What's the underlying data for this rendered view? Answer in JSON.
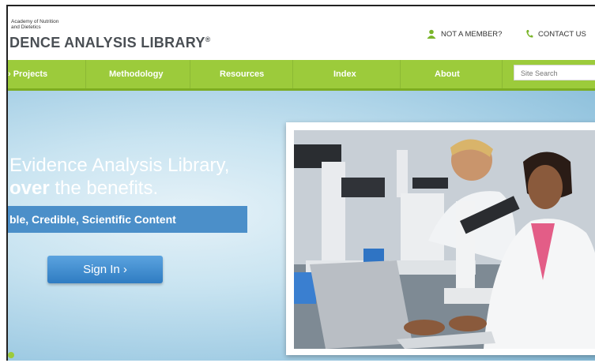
{
  "header": {
    "org_line1": "Academy of Nutrition",
    "org_line2": "and Dietetics",
    "title": "DENCE ANALYSIS LIBRARY",
    "title_mark": "®",
    "not_member": "NOT A MEMBER?",
    "contact_us": "CONTACT US"
  },
  "nav": {
    "items": [
      {
        "label": "› Projects"
      },
      {
        "label": "Methodology"
      },
      {
        "label": "Resources"
      },
      {
        "label": "Index"
      },
      {
        "label": "About"
      }
    ],
    "search_placeholder": "Site Search"
  },
  "hero": {
    "headline_line1": "Evidence Analysis Library,",
    "headline_bold": "over",
    "headline_rest": " the benefits.",
    "banner": "ble, Credible, Scientific Content",
    "signin": "Sign In  ›"
  },
  "icons": {
    "member": "person-icon",
    "contact": "phone-icon"
  },
  "colors": {
    "nav_green": "#9ccb3b",
    "icon_green": "#7ab52a",
    "banner_blue": "#4b8fc9",
    "button_blue": "#3a88cc"
  }
}
